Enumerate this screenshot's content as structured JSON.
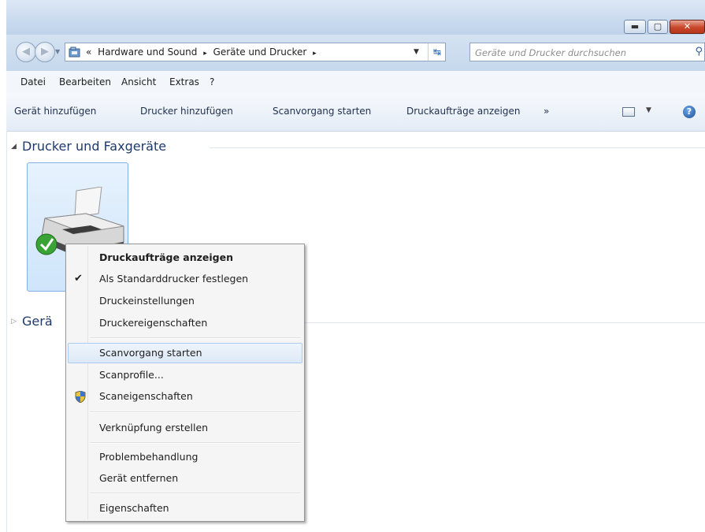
{
  "window": {
    "caption_buttons": [
      "minimize-icon",
      "maximize-icon",
      "close-icon"
    ]
  },
  "nav": {
    "back_icon": "back-arrow-icon",
    "forward_icon": "forward-arrow-icon"
  },
  "address": {
    "overflow": "«",
    "crumbs": [
      "Hardware und Sound",
      "Geräte und Drucker"
    ],
    "separator": "▸"
  },
  "search": {
    "placeholder": "Geräte und Drucker durchsuchen"
  },
  "menubar": {
    "items": [
      "Datei",
      "Bearbeiten",
      "Ansicht",
      "Extras",
      "?"
    ]
  },
  "commandbar": {
    "items": [
      "Gerät hinzufügen",
      "Drucker hinzufügen",
      "Scanvorgang starten",
      "Druckaufträge anzeigen"
    ],
    "more": "»"
  },
  "groups": {
    "printers_title": "Drucker und Faxgeräte",
    "devices_title": "Gerä"
  },
  "context_menu": {
    "items": [
      "Druckaufträge anzeigen",
      "Als Standarddrucker festlegen",
      "Druckeinstellungen",
      "Druckereigenschaften",
      "Scanvorgang starten",
      "Scanprofile...",
      "Scaneigenschaften",
      "Verknüpfung erstellen",
      "Problembehandlung",
      "Gerät entfernen",
      "Eigenschaften"
    ],
    "bold_item": "Druckaufträge anzeigen",
    "checked_item": "Als Standarddrucker festlegen",
    "highlighted_item": "Scanvorgang starten",
    "shield_item": "Scaneigenschaften"
  },
  "colors": {
    "titlebar": "#c9daee",
    "selection": "#cfe5fb",
    "group_title": "#1e3a6b",
    "default_check": "#3aa335"
  }
}
